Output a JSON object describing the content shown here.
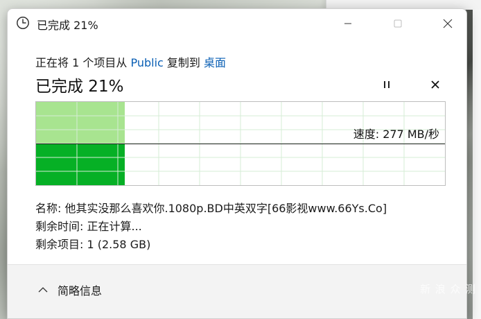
{
  "window": {
    "title": "已完成 21%"
  },
  "copy": {
    "prefix": "正在将 1 个项目从 ",
    "source": "Public",
    "middle": " 复制到 ",
    "destination": "桌面",
    "status": "已完成 21%",
    "percent": 0.21
  },
  "graph": {
    "speed_label": "速度: 277 MB/秒",
    "colors": {
      "progress": "#a8e490",
      "speed": "#06b025"
    }
  },
  "info": {
    "name": "名称: 他其实没那么喜欢你.1080p.BD中英双字[66影视www.66Ys.Co]",
    "time_left": "剩余时间: 正在计算...",
    "items_left": "剩余项目: 1 (2.58 GB)"
  },
  "footer": {
    "details_label": "简略信息"
  },
  "icons": {
    "title": "clock-icon",
    "pause": "pause-icon",
    "stop": "close-icon",
    "details": "chevron-up-icon"
  },
  "watermark": "值 什么值得买"
}
